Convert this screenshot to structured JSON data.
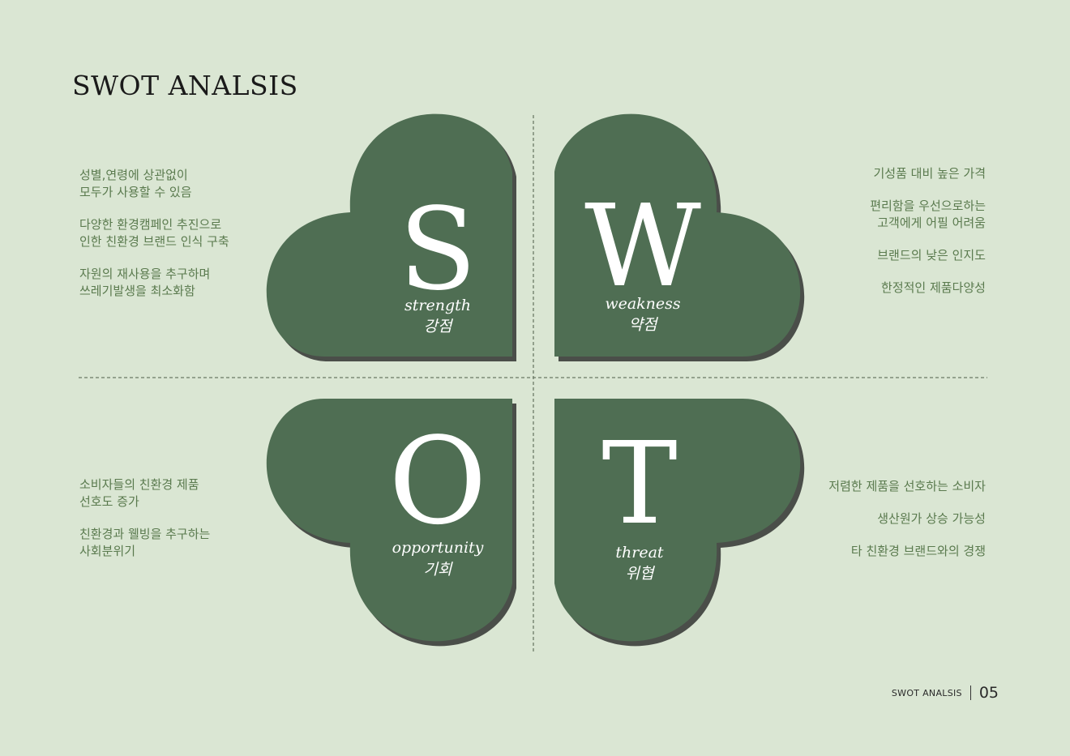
{
  "title": "SWOT ANALSIS",
  "colors": {
    "background": "#dae6d3",
    "leaf": "#4f6e53",
    "leaf_shadow": "#4a4e49",
    "note_text": "#5a7a4e",
    "letter": "#ffffff"
  },
  "quadrants": {
    "strength": {
      "letter": "S",
      "english": "strength",
      "korean": "강점"
    },
    "weakness": {
      "letter": "W",
      "english": "weakness",
      "korean": "약점"
    },
    "opportunity": {
      "letter": "O",
      "english": "opportunity",
      "korean": "기회"
    },
    "threat": {
      "letter": "T",
      "english": "threat",
      "korean": "위협"
    }
  },
  "notes": {
    "strength": [
      "성별,연령에 상관없이\n모두가 사용할 수 있음",
      "다양한 환경캠페인 추진으로\n인한 친환경 브랜드 인식 구축",
      "자원의 재사용을 추구하며\n쓰레기발생을 최소화함"
    ],
    "weakness": [
      "기성품 대비 높은 가격",
      "편리함을 우선으로하는\n고객에게 어필 어려움",
      "브랜드의 낮은 인지도",
      "한정적인 제품다양성"
    ],
    "opportunity": [
      "소비자들의 친환경 제품\n선호도 증가",
      "친환경과 웰빙을 추구하는\n사회분위기"
    ],
    "threat": [
      "저렴한 제품을 선호하는 소비자",
      "생산원가 상승 가능성",
      "타 친환경 브랜드와의 경쟁"
    ]
  },
  "footer": {
    "label": "SWOT ANALSIS",
    "page": "05"
  }
}
